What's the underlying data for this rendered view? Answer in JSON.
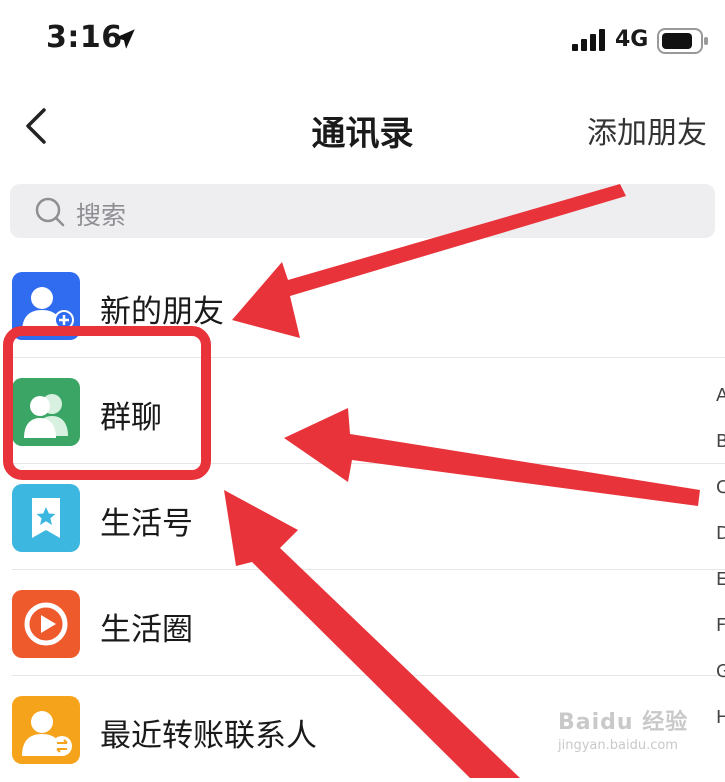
{
  "status_bar": {
    "time": "3:16",
    "network": "4G",
    "icons": [
      "location-arrow-icon",
      "signal-icon",
      "battery-icon"
    ]
  },
  "nav": {
    "title": "通讯录",
    "action": "添加朋友",
    "back_icon": "chevron-left-icon"
  },
  "search": {
    "placeholder": "搜索",
    "icon": "search-icon"
  },
  "list": {
    "items": [
      {
        "label": "新的朋友",
        "icon": "add-friend-icon",
        "color": "#2f6cf0"
      },
      {
        "label": "群聊",
        "icon": "group-chat-icon",
        "color": "#3aa565"
      },
      {
        "label": "生活号",
        "icon": "life-account-icon",
        "color": "#3cb7e0"
      },
      {
        "label": "生活圈",
        "icon": "life-circle-icon",
        "color": "#ee5a2c"
      },
      {
        "label": "最近转账联系人",
        "icon": "transfer-contact-icon",
        "color": "#f5a31a"
      }
    ]
  },
  "index_bar": [
    "A",
    "B",
    "C",
    "D",
    "E",
    "F",
    "G",
    "H"
  ],
  "annotation": {
    "color": "#e8333a"
  },
  "watermark": {
    "main": "Baidu 经验",
    "sub": "jingyan.baidu.com"
  }
}
